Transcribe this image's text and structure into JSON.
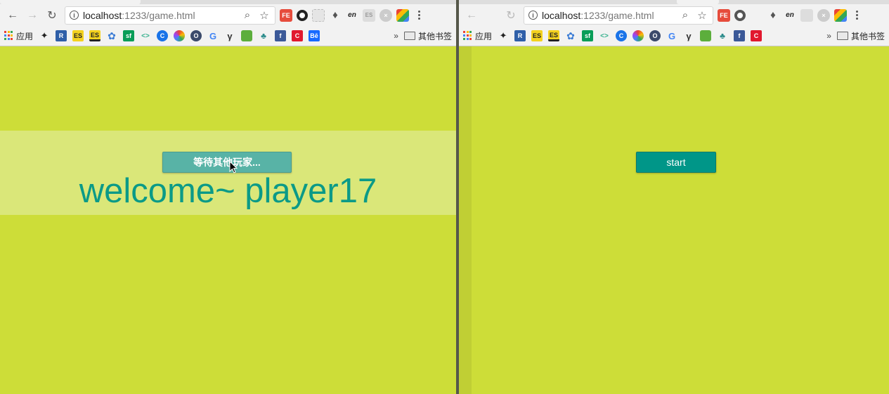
{
  "left_browser": {
    "url_host": "localhost",
    "url_path": ":1233/game.html",
    "extensions": [
      "FE",
      "ring",
      "grey",
      "evernote",
      "en",
      "ES",
      "cx",
      "multi"
    ],
    "bookmarks": [
      {
        "icon": "apps",
        "label": "应用"
      },
      {
        "icon": "bird",
        "label": ""
      },
      {
        "icon": "R",
        "label": ""
      },
      {
        "icon": "ES",
        "label": ""
      },
      {
        "icon": "ES",
        "label": ""
      },
      {
        "icon": "gear",
        "label": ""
      },
      {
        "icon": "sf",
        "label": ""
      },
      {
        "icon": "code",
        "label": ""
      },
      {
        "icon": "C",
        "label": ""
      },
      {
        "icon": "color",
        "label": ""
      },
      {
        "icon": "O",
        "label": ""
      },
      {
        "icon": "G",
        "label": ""
      },
      {
        "icon": "ya",
        "label": ""
      },
      {
        "icon": "cube",
        "label": ""
      },
      {
        "icon": "tree",
        "label": ""
      },
      {
        "icon": "f",
        "label": ""
      },
      {
        "icon": "C",
        "label": ""
      },
      {
        "icon": "Be",
        "label": ""
      }
    ],
    "more_chevron": "»",
    "other_bookmarks": "其他书签"
  },
  "right_browser": {
    "url_host": "localhost",
    "url_path": ":1233/game.html",
    "other_bookmarks": "其他书签",
    "more_chevron": "»"
  },
  "left_page": {
    "wait_button_label": "等待其他玩家...",
    "welcome_text": "welcome~ player17"
  },
  "right_page": {
    "start_button_label": "start"
  },
  "colors": {
    "page_bg": "#cddd38",
    "band_bg": "#dae779",
    "accent": "#009688",
    "accent_light": "#58b3a6",
    "welcome_text": "#0b9a87"
  }
}
